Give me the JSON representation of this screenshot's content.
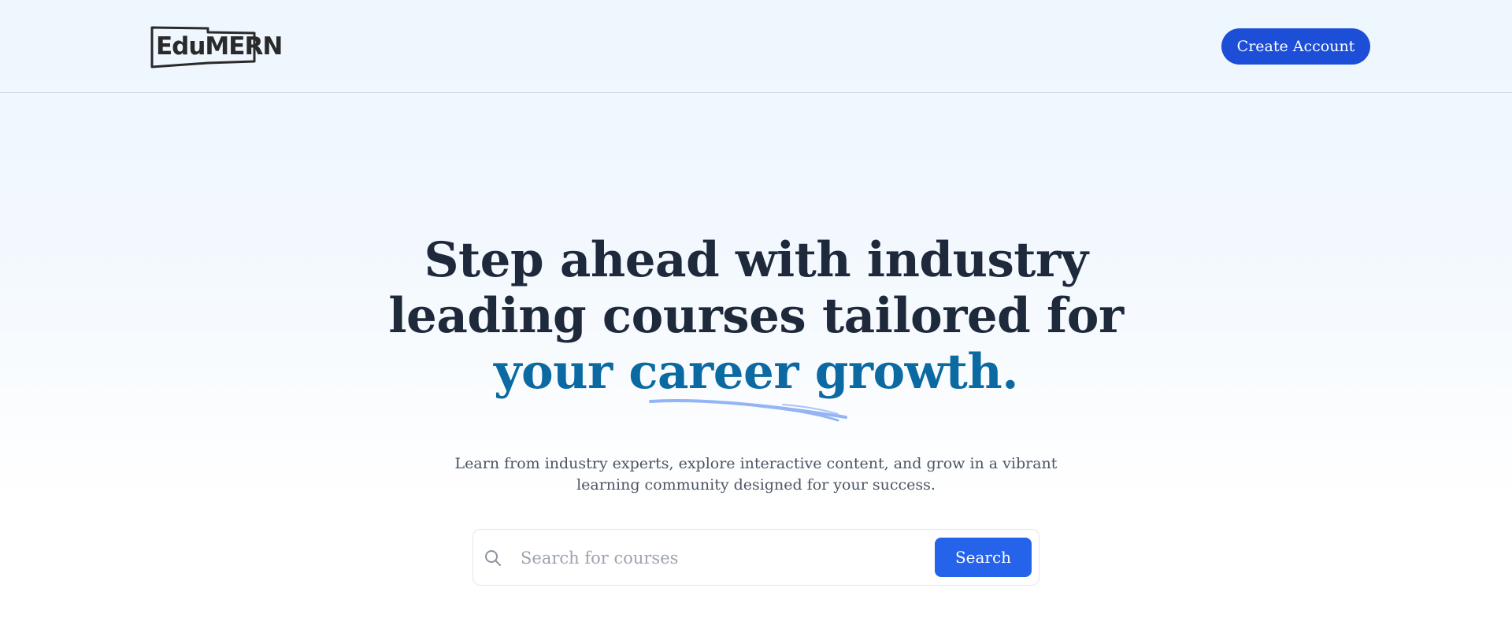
{
  "header": {
    "logo_text": "EduMERN",
    "create_account_label": "Create Account"
  },
  "hero": {
    "title_line1": "Step ahead with industry",
    "title_line2": "leading courses tailored for",
    "title_accent": "your career growth.",
    "subtitle": "Learn from industry experts, explore interactive content, and grow in a vibrant learning community designed for your success."
  },
  "search": {
    "placeholder": "Search for courses",
    "value": "",
    "button_label": "Search",
    "icon": "search-icon"
  },
  "colors": {
    "primary_button": "#1d4ed8",
    "search_button": "#2563eb",
    "accent_text": "#0b6aa2",
    "heading": "#1e293b",
    "underline": "#93b4f5"
  }
}
